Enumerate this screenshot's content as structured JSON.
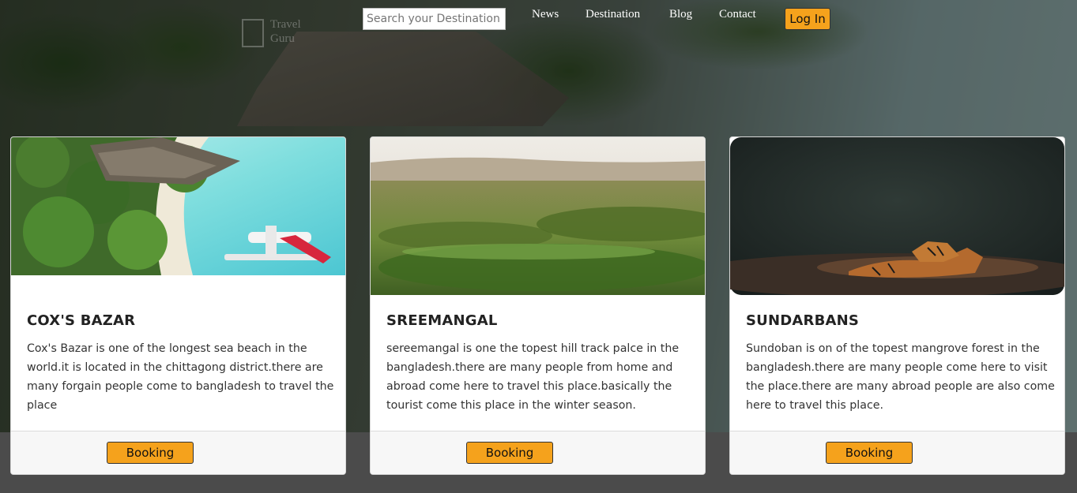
{
  "navbar": {
    "search_placeholder": "Search your Destination",
    "links": [
      "News",
      "Destination",
      "Blog",
      "Contact"
    ],
    "login_label": "Log In"
  },
  "cards": [
    {
      "title": "COX'S BAZAR",
      "description": "Cox's Bazar is one of the longest sea beach in the world.it is located in the chittagong district.there are many forgain people come to bangladesh to travel the place",
      "button": "Booking",
      "image": "beach-resort-image"
    },
    {
      "title": "SREEMANGAL",
      "description": "sereemangal is one the topest hill track palce in the bangladesh.there are many people from home and abroad come here to travel this place.basically the tourist come this place in the winter season.",
      "button": "Booking",
      "image": "tea-hills-image"
    },
    {
      "title": "SUNDARBANS",
      "description": "Sundoban is on of the topest mangrove forest in the bangladesh.there are many people come here to visit the place.there are many abroad people are also come here to travel this place.",
      "button": "Booking",
      "image": "tiger-forest-image"
    }
  ],
  "colors": {
    "accent": "#f5a21c",
    "card_bg": "#ffffff",
    "footer_bg": "#f7f7f7"
  }
}
